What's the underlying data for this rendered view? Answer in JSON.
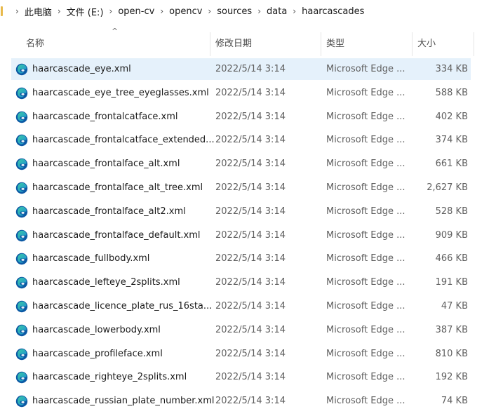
{
  "breadcrumb": [
    "此电脑",
    "文件 (E:)",
    "open-cv",
    "opencv",
    "sources",
    "data",
    "haarcascades"
  ],
  "columns": {
    "name": "名称",
    "date": "修改日期",
    "type": "类型",
    "size": "大小"
  },
  "files": [
    {
      "name": "haarcascade_eye.xml",
      "date": "2022/5/14 3:14",
      "type": "Microsoft Edge ...",
      "size": "334 KB"
    },
    {
      "name": "haarcascade_eye_tree_eyeglasses.xml",
      "date": "2022/5/14 3:14",
      "type": "Microsoft Edge ...",
      "size": "588 KB"
    },
    {
      "name": "haarcascade_frontalcatface.xml",
      "date": "2022/5/14 3:14",
      "type": "Microsoft Edge ...",
      "size": "402 KB"
    },
    {
      "name": "haarcascade_frontalcatface_extended...",
      "date": "2022/5/14 3:14",
      "type": "Microsoft Edge ...",
      "size": "374 KB"
    },
    {
      "name": "haarcascade_frontalface_alt.xml",
      "date": "2022/5/14 3:14",
      "type": "Microsoft Edge ...",
      "size": "661 KB"
    },
    {
      "name": "haarcascade_frontalface_alt_tree.xml",
      "date": "2022/5/14 3:14",
      "type": "Microsoft Edge ...",
      "size": "2,627 KB"
    },
    {
      "name": "haarcascade_frontalface_alt2.xml",
      "date": "2022/5/14 3:14",
      "type": "Microsoft Edge ...",
      "size": "528 KB"
    },
    {
      "name": "haarcascade_frontalface_default.xml",
      "date": "2022/5/14 3:14",
      "type": "Microsoft Edge ...",
      "size": "909 KB"
    },
    {
      "name": "haarcascade_fullbody.xml",
      "date": "2022/5/14 3:14",
      "type": "Microsoft Edge ...",
      "size": "466 KB"
    },
    {
      "name": "haarcascade_lefteye_2splits.xml",
      "date": "2022/5/14 3:14",
      "type": "Microsoft Edge ...",
      "size": "191 KB"
    },
    {
      "name": "haarcascade_licence_plate_rus_16sta...",
      "date": "2022/5/14 3:14",
      "type": "Microsoft Edge ...",
      "size": "47 KB"
    },
    {
      "name": "haarcascade_lowerbody.xml",
      "date": "2022/5/14 3:14",
      "type": "Microsoft Edge ...",
      "size": "387 KB"
    },
    {
      "name": "haarcascade_profileface.xml",
      "date": "2022/5/14 3:14",
      "type": "Microsoft Edge ...",
      "size": "810 KB"
    },
    {
      "name": "haarcascade_righteye_2splits.xml",
      "date": "2022/5/14 3:14",
      "type": "Microsoft Edge ...",
      "size": "192 KB"
    },
    {
      "name": "haarcascade_russian_plate_number.xml",
      "date": "2022/5/14 3:14",
      "type": "Microsoft Edge ...",
      "size": "74 KB"
    }
  ],
  "selected_index": 0,
  "file_icon": "edge-document-icon",
  "colors": {
    "selection": "#e5f1fb",
    "folder": "#e8b94a",
    "edge_blue": "#0c59a4",
    "edge_teal": "#3bc9a6"
  }
}
